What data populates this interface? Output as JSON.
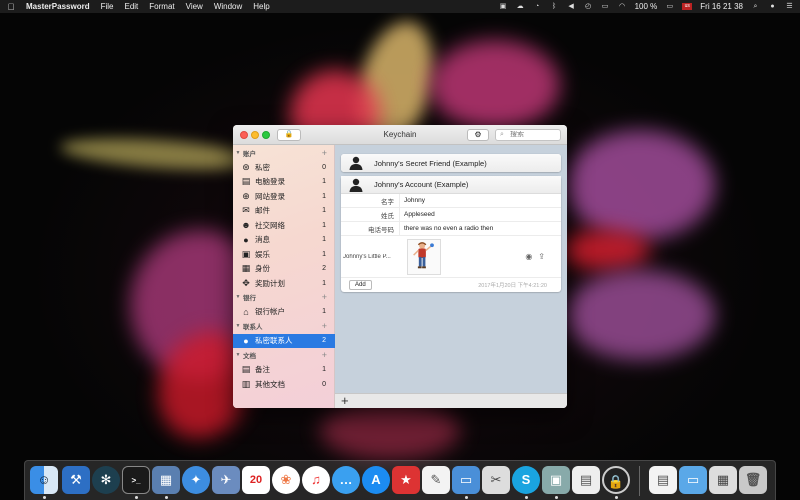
{
  "menubar": {
    "app_name": "MasterPassword",
    "menus": [
      "File",
      "Edit",
      "Format",
      "View",
      "Window",
      "Help"
    ],
    "battery": "100 %",
    "clock": "Fri 16 21 38"
  },
  "window": {
    "title": "Keychain",
    "search_placeholder": "搜索"
  },
  "sidebar": {
    "groups": [
      {
        "label": "账户",
        "items": [
          {
            "icon": "privacy-icon",
            "label": "私密",
            "count": "0"
          },
          {
            "icon": "computer-login-icon",
            "label": "电脑登录",
            "count": "1"
          },
          {
            "icon": "web-login-icon",
            "label": "网站登录",
            "count": "1"
          },
          {
            "icon": "mail-icon",
            "label": "邮件",
            "count": "1"
          },
          {
            "icon": "social-icon",
            "label": "社交网络",
            "count": "1"
          },
          {
            "icon": "message-icon",
            "label": "消息",
            "count": "1"
          },
          {
            "icon": "entertainment-icon",
            "label": "娱乐",
            "count": "1"
          },
          {
            "icon": "identity-icon",
            "label": "身份",
            "count": "2"
          },
          {
            "icon": "reward-icon",
            "label": "奖励计划",
            "count": "1"
          }
        ]
      },
      {
        "label": "银行",
        "items": [
          {
            "icon": "bank-icon",
            "label": "银行帐户",
            "count": "1"
          }
        ]
      },
      {
        "label": "联系人",
        "items": [
          {
            "icon": "contact-icon",
            "label": "私密联系人",
            "count": "2"
          }
        ]
      },
      {
        "label": "文档",
        "items": [
          {
            "icon": "note-icon",
            "label": "备注",
            "count": "1"
          },
          {
            "icon": "documents-icon",
            "label": "其他文档",
            "count": "0"
          }
        ]
      }
    ]
  },
  "cards": {
    "friend": {
      "title": "Johnny's Secret Friend (Example)"
    },
    "account": {
      "title": "Johnny's Account (Example)",
      "fields": [
        {
          "key": "名字",
          "value": "Johnny"
        },
        {
          "key": "姓氏",
          "value": "Appleseed"
        },
        {
          "key": "电话号码",
          "value": "there was no even a radio then"
        }
      ],
      "attachment_label": "Johnny's Little P...",
      "add_label": "Add",
      "timestamp": "2017年1月20日 下午4:21:20"
    }
  },
  "colors": {
    "selection": "#2a7ae2",
    "main_bg": "#c6d1dc"
  }
}
